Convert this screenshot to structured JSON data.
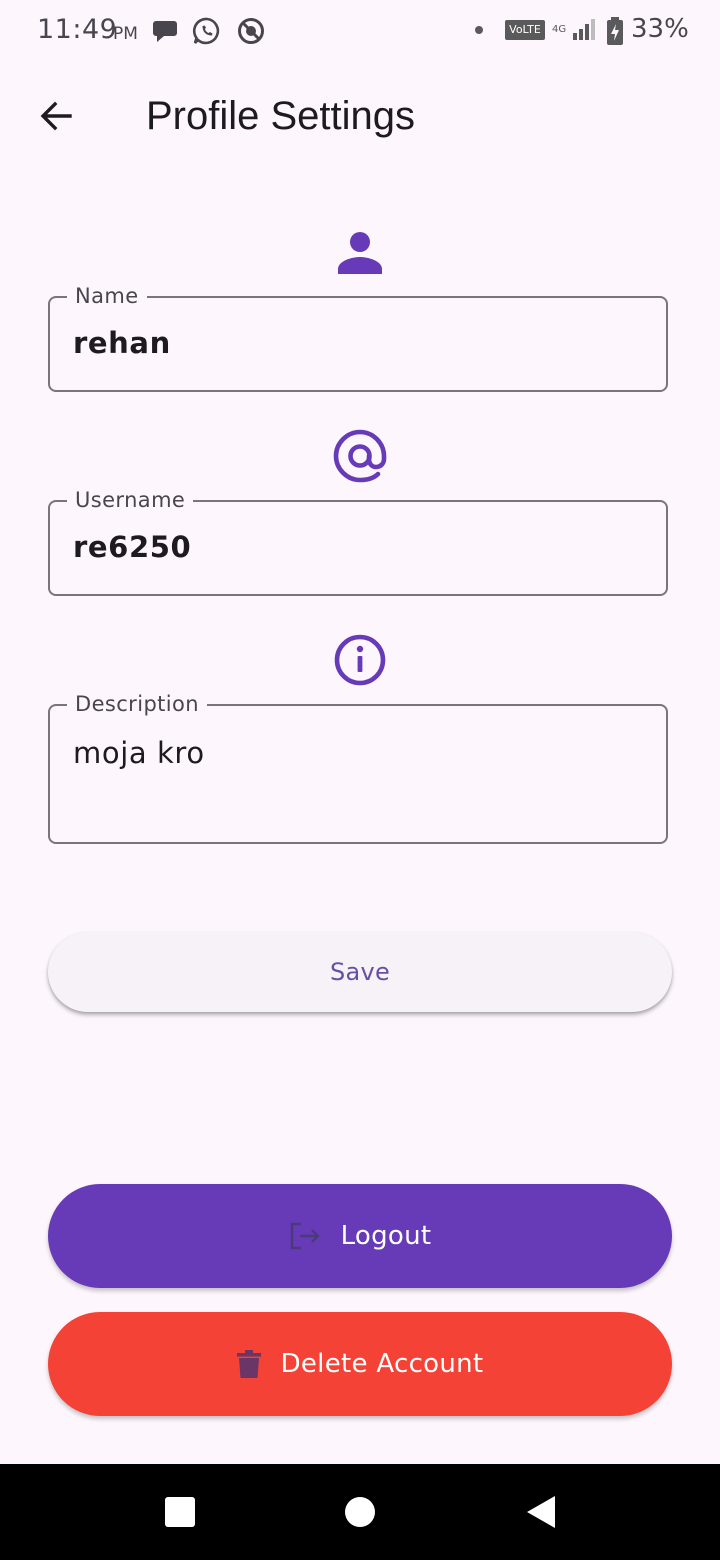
{
  "status_bar": {
    "time": "11:49",
    "ampm": "PM",
    "network_badge": "VoLTE",
    "network_type": "4G",
    "battery_percent": "33%"
  },
  "app_bar": {
    "title": "Profile Settings"
  },
  "form": {
    "name": {
      "label": "Name",
      "value": "rehan",
      "icon": "person-icon"
    },
    "username": {
      "label": "Username",
      "value": "re6250",
      "icon": "at-sign-icon"
    },
    "description": {
      "label": "Description",
      "value": "moja kro",
      "icon": "info-icon"
    }
  },
  "buttons": {
    "save_label": "Save",
    "logout_label": "Logout",
    "delete_label": "Delete Account"
  },
  "colors": {
    "accent": "#673ab7",
    "danger": "#f44336",
    "background": "#fdf7fd",
    "outline": "#79747e"
  },
  "nav": {
    "recents": "square-icon",
    "home": "circle-icon",
    "back": "triangle-back-icon"
  }
}
